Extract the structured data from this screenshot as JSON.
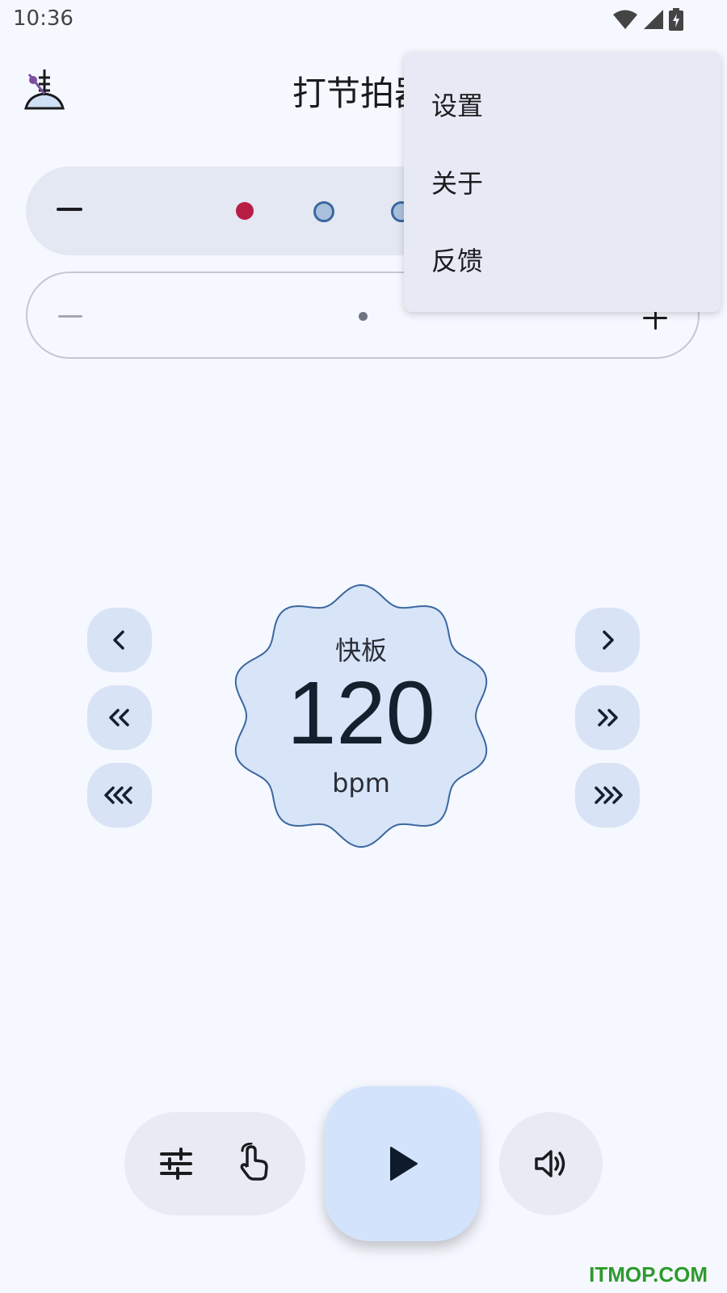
{
  "status_bar": {
    "time": "10:36",
    "icons": [
      "wifi-icon",
      "signal-icon",
      "battery-charging-icon"
    ]
  },
  "app_bar": {
    "title": "打节拍器",
    "logo_icon": "metronome-logo-icon"
  },
  "beats": {
    "minus_icon": "minus-icon",
    "dots": [
      {
        "state": "accent",
        "color": "#b81d46"
      },
      {
        "state": "normal",
        "color": "#a9c0dc"
      },
      {
        "state": "normal",
        "color": "#a9c0dc"
      }
    ]
  },
  "subdivision": {
    "minus_icon": "minus-icon",
    "plus_icon": "plus-icon"
  },
  "tempo": {
    "name": "快板",
    "bpm": "120",
    "unit": "bpm",
    "decrease_buttons": [
      "chevron-left-icon",
      "double-chevron-left-icon",
      "triple-chevron-left-icon"
    ],
    "increase_buttons": [
      "chevron-right-icon",
      "double-chevron-right-icon",
      "triple-chevron-right-icon"
    ]
  },
  "controls": {
    "settings_icon": "sliders-icon",
    "tap_icon": "tap-hand-icon",
    "play_icon": "play-icon",
    "sound_icon": "volume-icon"
  },
  "menu": {
    "items": [
      "设置",
      "关于",
      "反馈"
    ]
  },
  "watermark": "ITMOP.COM",
  "colors": {
    "background": "#f6f8ff",
    "accent": "#b81d46",
    "primary": "#3a68a0",
    "fab": "#d3e3fb"
  }
}
